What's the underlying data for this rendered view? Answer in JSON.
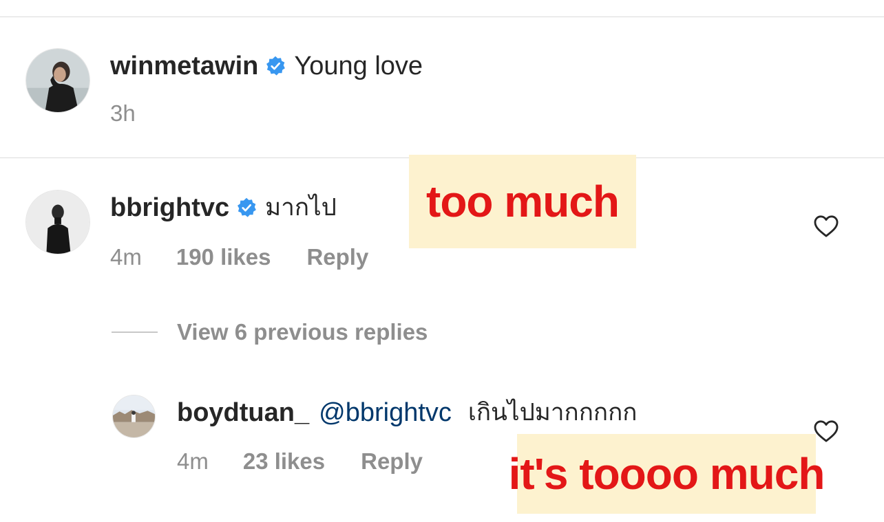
{
  "post": {
    "username": "winmetawin",
    "caption": "Young love",
    "time": "3h",
    "verified_icon": "verified-badge-icon"
  },
  "comment": {
    "username": "bbrightvc",
    "text": "มากไป",
    "time": "4m",
    "likes": "190 likes",
    "reply_label": "Reply",
    "annotation": "too much",
    "like_icon": "heart-icon"
  },
  "view_replies": {
    "label": "View 6 previous replies"
  },
  "reply": {
    "username": "boydtuan_",
    "mention": "@bbrightvc",
    "text": "เกินไปมากกกกก",
    "time": "4m",
    "likes": "23 likes",
    "reply_label": "Reply",
    "annotation": "it's toooo much",
    "like_icon": "heart-icon"
  },
  "colors": {
    "verified_blue": "#3897f0",
    "mention_blue": "#00376b",
    "annotation_bg": "#fdf2cf",
    "annotation_text": "#e31717",
    "meta_gray": "#8e8e8e"
  }
}
